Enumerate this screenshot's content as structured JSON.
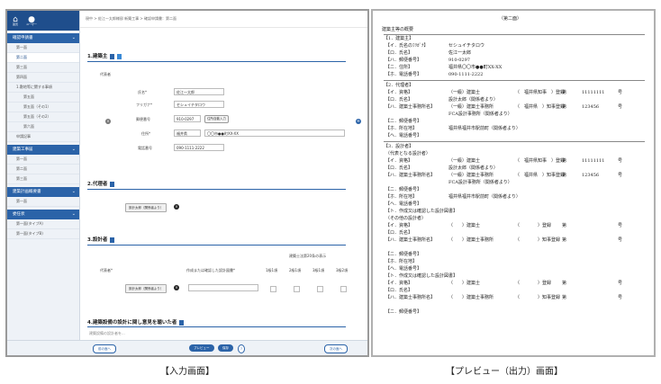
{
  "captions": {
    "input": "【入力画面】",
    "preview": "【プレビュー（出力）画面】"
  },
  "sidebar": {
    "top_icons": [
      {
        "label": "首页",
        "icon": "home-icon"
      },
      {
        "label": "ユーザー",
        "icon": "user-icon"
      }
    ],
    "sections": [
      {
        "label": "確認申請書",
        "items": [
          "第一面",
          "第二面",
          "第三面",
          "第四面",
          "1.敷地等に関する事項",
          "第五面",
          "第五面（その1）",
          "第五面（その2）",
          "第六面",
          "申請記事"
        ],
        "active": 1
      },
      {
        "label": "建築工事届",
        "items": [
          "第一面",
          "第二面",
          "第三面"
        ]
      },
      {
        "label": "建築計画概要書",
        "items": [
          "第一面"
        ]
      },
      {
        "label": "委任状",
        "items": [
          "第一面(タイプA)",
          "第一面(タイプB)"
        ]
      }
    ]
  },
  "breadcrumb": "現中 > 佐江一太郎様邸 新築工事 > 確認申請書：第二面",
  "form": {
    "s1_title": "1.建築主",
    "s1_rep": "代表者",
    "name_label": "氏名*",
    "name_value": "佐江一太郎",
    "kana_label": "フリガナ*",
    "kana_value": "セシュイチタロウ",
    "zip_label": "郵便番号",
    "zip_value": "910-0297",
    "zip_btn": "住所自動入力",
    "addr_label": "住所*",
    "addr_pref": "福井県",
    "addr_value": "〇〇市●●町XX-XX",
    "tel_label": "電話番号",
    "tel_value": "090-1111-2222",
    "s2_title": "2.代理者",
    "s2_chip": "設計太郎（関係者より）",
    "s3_title": "3.設計者",
    "s3_col_main": "作成または確認した設計図書*",
    "s3_col_kind": "建築士法第20条の表示",
    "s3_rep": "代表者*",
    "s3_chip": "設計太郎（関係者より）",
    "s3_cols": [
      "1級1項",
      "2級1項",
      "3級1項",
      "3級2項"
    ],
    "s4_title": "4.建築設備の設計に関し意見を聴いた者",
    "s4_note": "建築設備の設計者を..."
  },
  "footer": {
    "back": "前の面へ",
    "preview": "プレビュー",
    "save": "保存",
    "help": "?",
    "next": "次の面へ"
  },
  "preview": {
    "header": "（第二面）",
    "title": "建築主等の概要",
    "s1": "【1．建築主】",
    "s1_rows": [
      [
        "【イ．氏名のﾌﾘｶﾞﾅ】",
        "セシュイチタロウ"
      ],
      [
        "【ロ．氏名】",
        "佐江一太郎"
      ],
      [
        "【ハ．郵便番号】",
        "910-0297"
      ],
      [
        "【ニ．住所】",
        "福井県〇〇市●●町XX-XX"
      ],
      [
        "【ホ．電話番号】",
        "090-1111-2222"
      ]
    ],
    "s2": "【2．代理者】",
    "s2_rows": [
      [
        "【イ．資格】",
        "（一級）建築士",
        "（　福井県知事　）登録",
        "第",
        "11111111",
        "号"
      ],
      [
        "【ロ．氏名】",
        "設計太郎（関係者より）",
        "",
        "",
        "",
        ""
      ],
      [
        "【ハ．建築士事務所名】",
        "（一級）建築士事務所",
        "（　福井県　）知事登録",
        "第",
        "123456",
        "号"
      ],
      [
        "",
        "FCA設計事務所（関係者より）",
        "",
        "",
        "",
        ""
      ],
      [
        "【ニ．郵便番号】",
        "",
        "",
        "",
        "",
        ""
      ],
      [
        "【ホ．所在地】",
        "福井県福井市駅前町（関係者より）",
        "",
        "",
        "",
        ""
      ],
      [
        "【ヘ．電話番号】",
        "",
        "",
        "",
        "",
        ""
      ]
    ],
    "s3": "【3．設計者】",
    "s3_rep": "（代表となる設計者）",
    "s3_rows": [
      [
        "【イ．資格】",
        "（一級）建築士",
        "（　福井県知事　）登録",
        "第",
        "11111111",
        "号"
      ],
      [
        "【ロ．氏名】",
        "設計太郎（関係者より）",
        "",
        "",
        "",
        ""
      ],
      [
        "【ハ．建築士事務所名】",
        "（一級）建築士事務所",
        "（　福井県　）知事登録",
        "第",
        "123456",
        "号"
      ],
      [
        "",
        "FCA設計事務所（関係者より）",
        "",
        "",
        "",
        ""
      ],
      [
        "【ニ．郵便番号】",
        "",
        "",
        "",
        "",
        ""
      ],
      [
        "【ホ．所在地】",
        "福井県福井市駅前町（関係者より）",
        "",
        "",
        "",
        ""
      ],
      [
        "【ヘ．電話番号】",
        "",
        "",
        "",
        "",
        ""
      ],
      [
        "【ト．作成又は確認した設計図書】",
        "",
        "",
        "",
        "",
        ""
      ]
    ],
    "s3_other": "（その他の設計者）",
    "blank_rows": [
      [
        "【イ．資格】",
        "（　　）建築士",
        "（　　　　）登録",
        "第",
        "",
        "号"
      ],
      [
        "【ロ．氏名】",
        "",
        "",
        "",
        "",
        ""
      ],
      [
        "【ハ．建築士事務所名】",
        "（　　）建築士事務所",
        "（　　　　）知事登録",
        "第",
        "",
        "号"
      ],
      [
        "",
        "",
        "",
        "",
        "",
        ""
      ],
      [
        "【ニ．郵便番号】",
        "",
        "",
        "",
        "",
        ""
      ],
      [
        "【ホ．所在地】",
        "",
        "",
        "",
        "",
        ""
      ],
      [
        "【ヘ．電話番号】",
        "",
        "",
        "",
        "",
        ""
      ],
      [
        "【ト．作成又は確認した設計図書】",
        "",
        "",
        "",
        "",
        ""
      ]
    ],
    "blank_rows2": [
      [
        "【イ．資格】",
        "（　　）建築士",
        "（　　　　）登録",
        "第",
        "",
        "号"
      ],
      [
        "【ロ．氏名】",
        "",
        "",
        "",
        "",
        ""
      ],
      [
        "【ハ．建築士事務所名】",
        "（　　）建築士事務所",
        "（　　　　）知事登録",
        "第",
        "",
        "号"
      ],
      [
        "",
        "",
        "",
        "",
        "",
        ""
      ],
      [
        "【ニ．郵便番号】",
        "",
        "",
        "",
        "",
        ""
      ]
    ]
  }
}
